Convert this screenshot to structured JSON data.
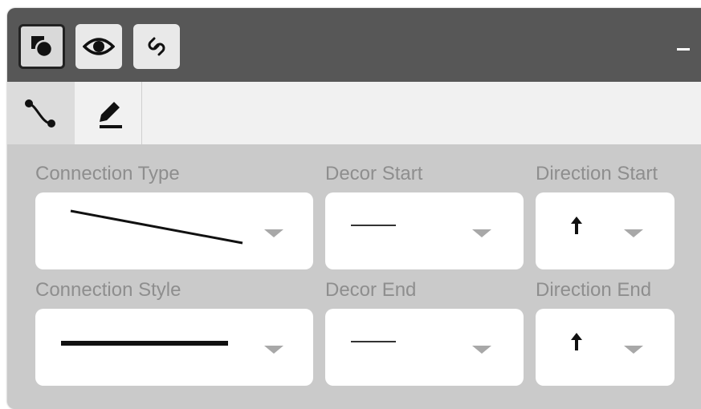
{
  "toolbar": {
    "buttons": [
      {
        "icon": "shapes-icon",
        "active": true
      },
      {
        "icon": "eye-icon",
        "active": false
      },
      {
        "icon": "link-icon",
        "active": false
      }
    ],
    "minimize_icon": "minimize-icon"
  },
  "tabs": [
    {
      "icon": "connection-curve-icon",
      "active": true
    },
    {
      "icon": "pencil-edit-icon",
      "active": false
    }
  ],
  "fields": {
    "connection_type": {
      "label": "Connection Type",
      "value_icon": "diagonal-line-icon"
    },
    "decor_start": {
      "label": "Decor Start",
      "value_icon": "thin-line-icon"
    },
    "direction_start": {
      "label": "Direction Start",
      "value_icon": "up-arrow-icon"
    },
    "connection_style": {
      "label": "Connection Style",
      "value_icon": "thick-line-icon"
    },
    "decor_end": {
      "label": "Decor End",
      "value_icon": "thin-line-icon"
    },
    "direction_end": {
      "label": "Direction End",
      "value_icon": "up-arrow-icon"
    }
  },
  "colors": {
    "header_bg": "#575757",
    "panel_bg": "#cacaca",
    "tab_bar_bg": "#f1f1f1",
    "label_text": "#8e8e8e",
    "caret": "#a8a8a8"
  }
}
